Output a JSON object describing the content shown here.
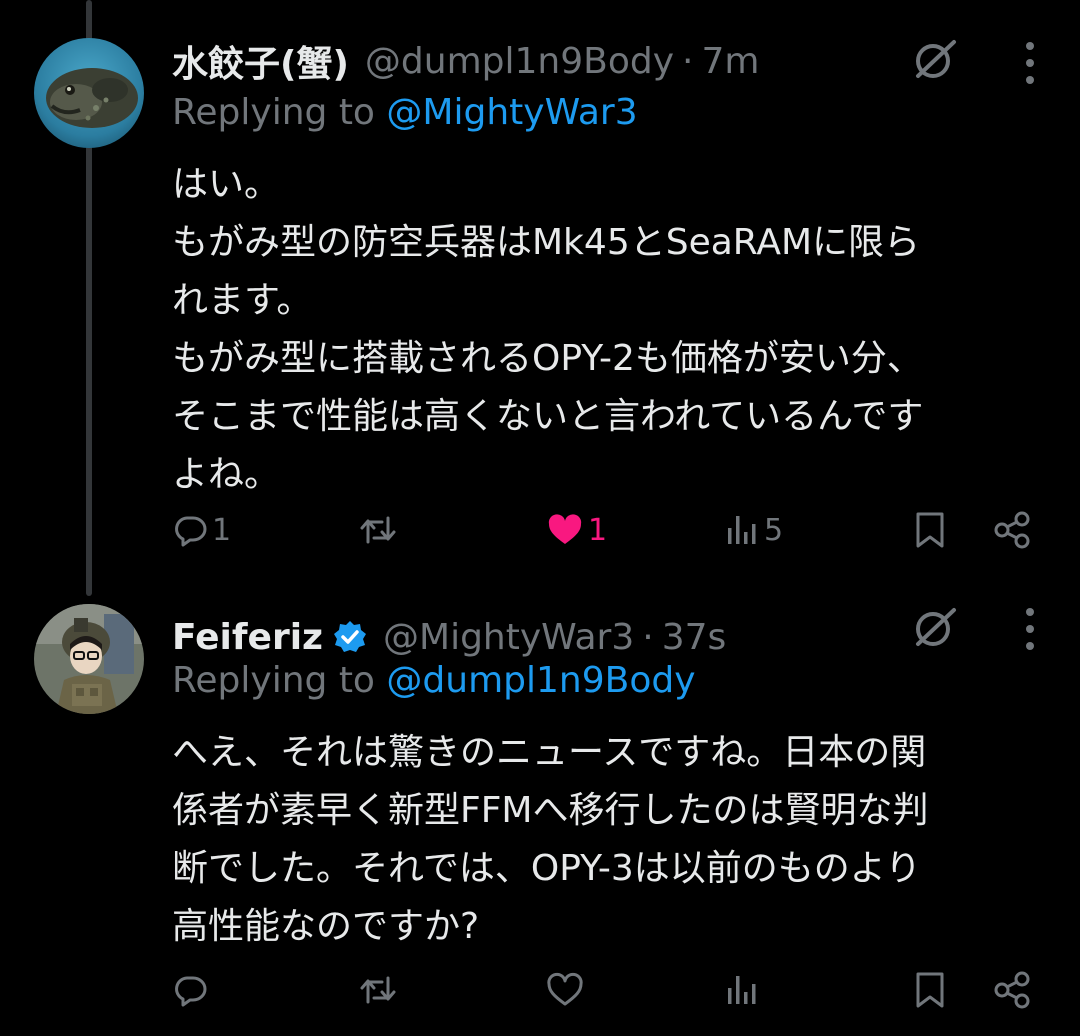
{
  "tweets": [
    {
      "display_name": "水餃子(蟹)",
      "handle": "@dumpl1n9Body",
      "separator": "·",
      "time": "7m",
      "replying_prefix": "Replying to",
      "replying_to": "@MightyWar3",
      "lines": [
        "はい。",
        "もがみ型の防空兵器はMk45とSeaRAMに限ら",
        "れます。",
        "もがみ型に搭載されるOPY-2も価格が安い分、",
        "そこまで性能は高くないと言われているんです",
        "よね。"
      ],
      "actions": {
        "reply_count": "1",
        "retweet_count": "",
        "like_count": "1",
        "views_count": "5"
      }
    },
    {
      "display_name": "Feiferiz",
      "handle": "@MightyWar3",
      "separator": "·",
      "time": "37s",
      "replying_prefix": "Replying to",
      "replying_to": "@dumpl1n9Body",
      "lines": [
        "へえ、それは驚きのニュースですね。日本の関",
        "係者が素早く新型FFMへ移行したのは賢明な判",
        "断でした。それでは、OPY-3は以前のものより",
        "高性能なのですか?"
      ],
      "actions": {
        "reply_count": "",
        "retweet_count": "",
        "like_count": "",
        "views_count": ""
      }
    }
  ],
  "colors": {
    "background": "#000000",
    "text_primary": "#e7e9ea",
    "text_secondary": "#71767b",
    "link": "#1d9bf0",
    "like": "#f91880",
    "verified": "#1d9bf0"
  },
  "icons": {
    "reply": "reply-bubble-icon",
    "retweet": "retweet-icon",
    "like": "heart-icon",
    "views": "views-chart-icon",
    "bookmark": "bookmark-icon",
    "share": "share-icon",
    "grok": "grok-icon",
    "more": "more-vertical-icon",
    "verified": "verified-badge-icon"
  }
}
